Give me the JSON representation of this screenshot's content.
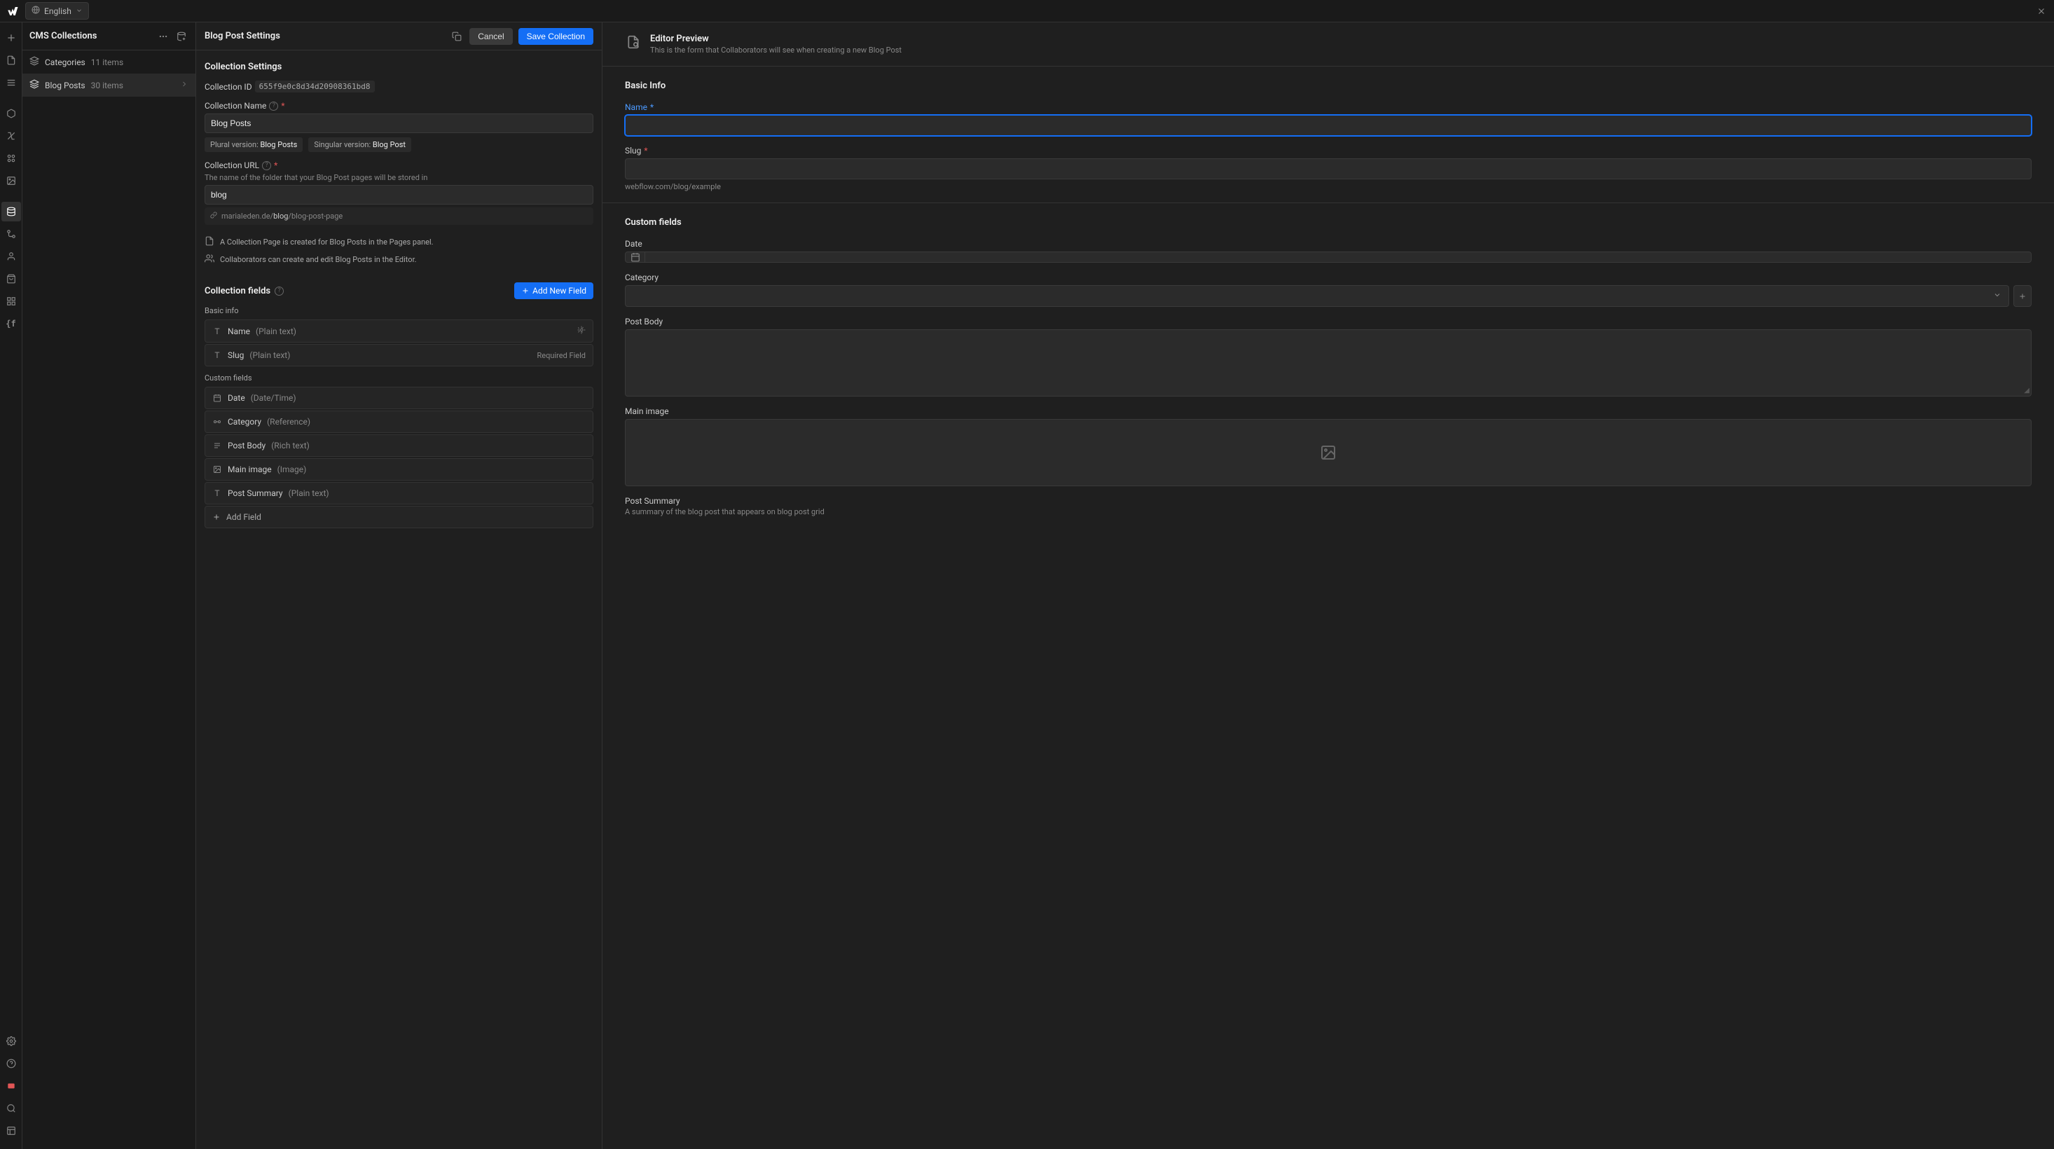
{
  "topbar": {
    "language": "English"
  },
  "collections": {
    "title": "CMS Collections",
    "items": [
      {
        "name": "Categories",
        "count": "11 items"
      },
      {
        "name": "Blog Posts",
        "count": "30 items"
      }
    ]
  },
  "settings": {
    "title": "Blog Post Settings",
    "cancel": "Cancel",
    "save": "Save Collection",
    "collection_settings_title": "Collection Settings",
    "collection_id_label": "Collection ID",
    "collection_id_value": "655f9e0c8d34d20908361bd8",
    "collection_name_label": "Collection Name",
    "collection_name_value": "Blog Posts",
    "plural_label": "Plural version:",
    "plural_value": "Blog Posts",
    "singular_label": "Singular version:",
    "singular_value": "Blog Post",
    "collection_url_label": "Collection URL",
    "collection_url_hint": "The name of the folder that your Blog Post pages will be stored in",
    "collection_url_value": "blog",
    "url_preview_prefix": "marialeden.de/",
    "url_preview_bold": "blog",
    "url_preview_suffix": "/blog-post-page",
    "info1": "A Collection Page is created for Blog Posts in the Pages panel.",
    "info2": "Collaborators can create and edit Blog Posts in the Editor.",
    "fields_title": "Collection fields",
    "add_new_field": "Add New Field",
    "basic_info_title": "Basic info",
    "custom_fields_title": "Custom fields",
    "required_field": "Required Field",
    "add_field": "Add Field",
    "basic_fields": [
      {
        "name": "Name",
        "type": "(Plain text)"
      },
      {
        "name": "Slug",
        "type": "(Plain text)"
      }
    ],
    "custom_fields": [
      {
        "name": "Date",
        "type": "(Date/Time)"
      },
      {
        "name": "Category",
        "type": "(Reference)"
      },
      {
        "name": "Post Body",
        "type": "(Rich text)"
      },
      {
        "name": "Main image",
        "type": "(Image)"
      },
      {
        "name": "Post Summary",
        "type": "(Plain text)"
      }
    ]
  },
  "preview": {
    "title": "Editor Preview",
    "subtitle": "This is the form that Collaborators will see when creating a new Blog Post",
    "basic_info": "Basic Info",
    "name_label": "Name",
    "slug_label": "Slug",
    "slug_hint": "webflow.com/blog/example",
    "custom_fields": "Custom fields",
    "date_label": "Date",
    "category_label": "Category",
    "post_body_label": "Post Body",
    "main_image_label": "Main image",
    "post_summary_label": "Post Summary",
    "post_summary_hint": "A summary of the blog post that appears on blog post grid"
  }
}
